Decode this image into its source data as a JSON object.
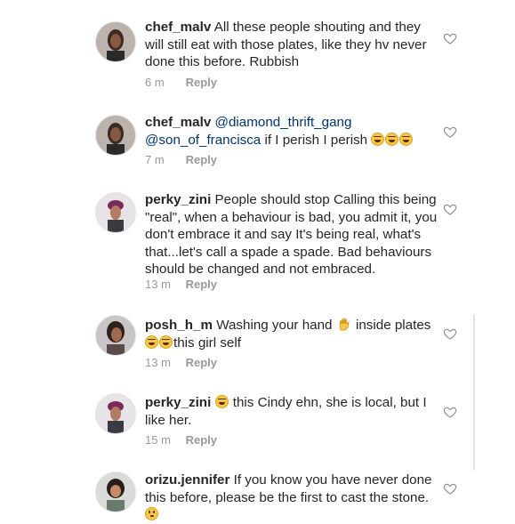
{
  "comments": [
    {
      "username": "chef_malv",
      "text": "All these people shouting and they will still eat with those plates, like they hv never done this before. Rubbish",
      "time": "6 m",
      "reply": "Reply"
    },
    {
      "username": "chef_malv",
      "mention": "@diamond_thrift_gang @son_of_francisca",
      "text": "if I perish I perish",
      "time": "7 m",
      "reply": "Reply"
    },
    {
      "username": "perky_zini",
      "text": "People should stop Calling this being \"real\", when a behaviour is bad, you admit it, you don't embrace it and say It's being real, what's that...let's call a spade a spade. Bad behaviours should be changed and not embraced.",
      "time": "13 m",
      "reply": "Reply"
    },
    {
      "username": "posh_h_m",
      "text_before": "Washing your hand",
      "text_after": "inside plates",
      "text_end": "this girl self",
      "time": "13 m",
      "reply": "Reply"
    },
    {
      "username": "perky_zini",
      "text": "this Cindy ehn, she is local, but I like her.",
      "time": "15 m",
      "reply": "Reply"
    },
    {
      "username": "orizu.jennifer",
      "text": "If you know you have never done this before, please be the first to cast the stone.",
      "time": "",
      "reply": ""
    }
  ],
  "icons": {
    "like": "heart-outline-icon",
    "laugh": "face-with-tears-of-joy-emoji",
    "hand": "raised-hand-emoji",
    "flushed": "flushed-face-emoji"
  },
  "colors": {
    "text": "#262626",
    "meta": "#999999",
    "mention": "#003569"
  }
}
